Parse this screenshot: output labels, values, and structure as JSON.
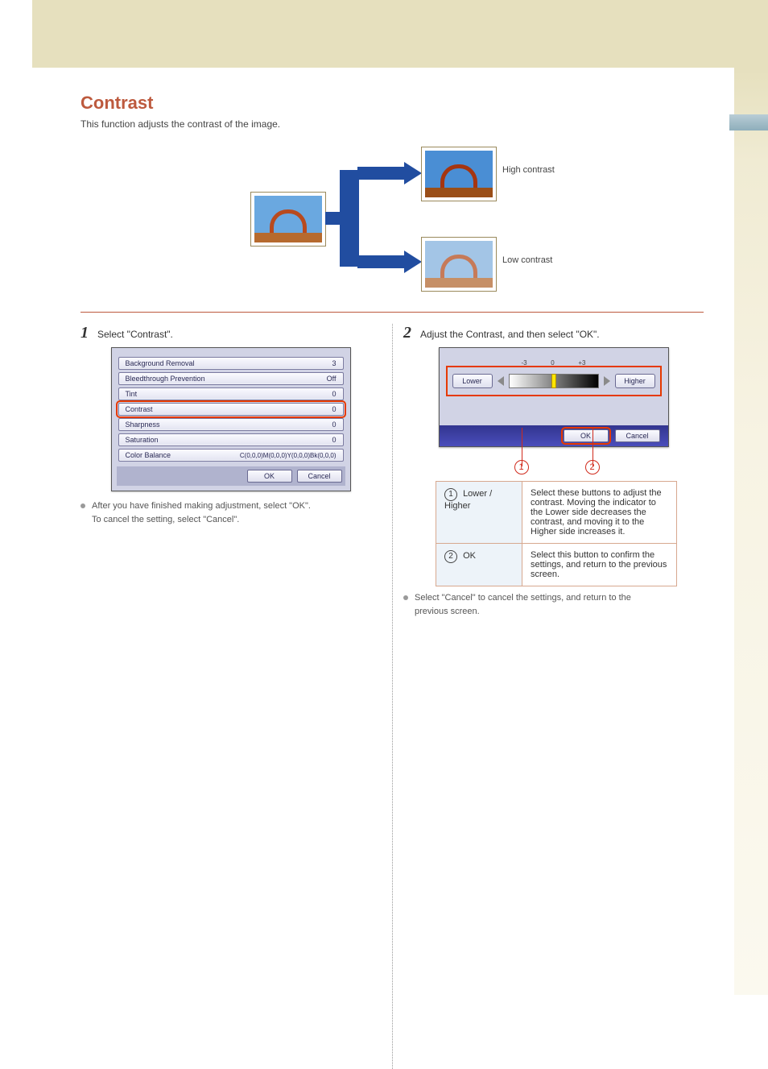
{
  "header": {
    "title": "Contrast"
  },
  "intro": "This function adjusts the contrast of the image.",
  "diagram": {
    "caption_high": "High contrast",
    "caption_low": "Low contrast"
  },
  "step1": {
    "num": "1",
    "text": "Select \"Contrast\".",
    "screen": {
      "rows": [
        {
          "label": "Background Removal",
          "value": "3",
          "selected": false
        },
        {
          "label": "Bleedthrough Prevention",
          "value": "Off",
          "selected": false
        },
        {
          "label": "Tint",
          "value": "0",
          "selected": false
        },
        {
          "label": "Contrast",
          "value": "0",
          "selected": true
        },
        {
          "label": "Sharpness",
          "value": "0",
          "selected": false
        },
        {
          "label": "Saturation",
          "value": "0",
          "selected": false
        },
        {
          "label": "Color Balance",
          "value": "C(0,0,0)M(0,0,0)Y(0,0,0)Bk(0,0,0)",
          "selected": false
        }
      ],
      "ok": "OK",
      "cancel": "Cancel"
    },
    "note_line1": "After you have finished making adjustment, select \"OK\".",
    "note_line2": "To cancel the setting, select \"Cancel\"."
  },
  "step2": {
    "num": "2",
    "text": "Adjust the Contrast, and then select \"OK\".",
    "screen": {
      "lower": "Lower",
      "higher": "Higher",
      "tick_neg": "-3",
      "tick_zero": "0",
      "tick_pos": "+3",
      "ok": "OK",
      "cancel": "Cancel"
    },
    "callout1": "1",
    "callout2": "2",
    "table": {
      "r1k_num": "1",
      "r1k_name": "Lower / Higher",
      "r1v": "Select these buttons to adjust the contrast. Moving the indicator to the Lower side decreases the contrast, and moving it to the Higher side increases it.",
      "r2k_num": "2",
      "r2k_name": "OK",
      "r2v": "Select this button to confirm the settings, and return to the previous screen."
    },
    "note_line1": "Select \"Cancel\" to cancel the settings, and return to the",
    "note_line2": "previous screen."
  }
}
